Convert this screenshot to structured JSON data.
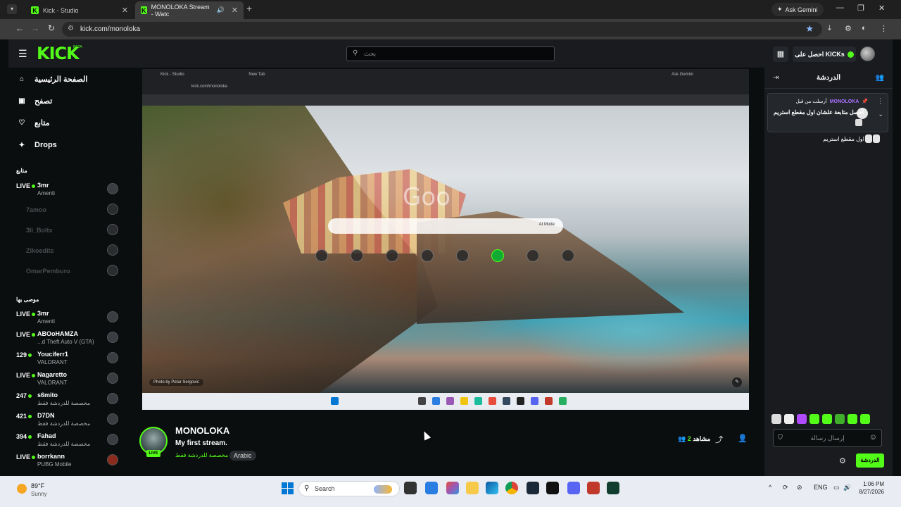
{
  "browser": {
    "tabs": [
      {
        "label": "Kick - Studio"
      },
      {
        "label": "MONOLOKA Stream - Watc"
      }
    ],
    "gemini_label": "Ask Gemini",
    "url": "kick.com/monoloka"
  },
  "header": {
    "logo": "KICK",
    "logo_badge": "BETA",
    "search_placeholder": "بحث",
    "kicks_button": "احصل على KICKs"
  },
  "sidebar": {
    "nav": [
      {
        "label": "الصفحة الرئيسية",
        "icon": "home-icon"
      },
      {
        "label": "تصفح",
        "icon": "browse-icon"
      },
      {
        "label": "متابع",
        "icon": "heart-icon"
      },
      {
        "label": "Drops",
        "icon": "drops-icon"
      }
    ],
    "following_heading": "متابع",
    "following": [
      {
        "status": "LIVE",
        "name": "3mr",
        "sub": "Amenti",
        "live": true
      },
      {
        "status": "",
        "name": "7amoo",
        "sub": "",
        "live": false
      },
      {
        "status": "",
        "name": "3li_Boltx",
        "sub": "",
        "live": false
      },
      {
        "status": "",
        "name": "Zikoedits",
        "sub": "",
        "live": false
      },
      {
        "status": "",
        "name": "OmarPemburu",
        "sub": "",
        "live": false
      }
    ],
    "recommended_heading": "موصى بها",
    "recommended": [
      {
        "status": "LIVE",
        "name": "3mr",
        "sub": "Amenti"
      },
      {
        "status": "LIVE",
        "name": "ABOoHAMZA",
        "sub": "...d Theft Auto V (GTA)"
      },
      {
        "status": "129",
        "name": "Youciferr1",
        "sub": "VALORANT"
      },
      {
        "status": "LIVE",
        "name": "Nagaretto",
        "sub": "VALORANT"
      },
      {
        "status": "247",
        "name": "s6mito",
        "sub": "مخصصة للدردشة فقط"
      },
      {
        "status": "421",
        "name": "D7DN",
        "sub": "مخصصة للدردشة فقط"
      },
      {
        "status": "394",
        "name": "Fahad",
        "sub": "مخصصة للدردشة فقط"
      },
      {
        "status": "LIVE",
        "name": "borrkann",
        "sub": "PUBG Mobile"
      }
    ]
  },
  "video": {
    "inner_tabs": [
      "Kick - Studio",
      "New Tab"
    ],
    "inner_url": "kick.com/monoloka",
    "inner_gemini": "Ask Gemini",
    "google_text": "Goo",
    "ai_mode": "AI Mode",
    "credit": "Photo by Petar Sergović"
  },
  "stream": {
    "name": "MONOLOKA",
    "title": "My first stream.",
    "category": "مخصصة للدردشة فقط",
    "tag": "Arabic",
    "live_badge": "LIVE",
    "viewers_count": "2",
    "viewers_label": "مشاهد"
  },
  "chat": {
    "title": "الدردشة",
    "pinned_by_label": "أرسلت من قبل",
    "pinned_user": "MONOLOKA",
    "pinned_message": "احصل متابعة علشان اول مقطع استريم",
    "message_text": "اول مقطع استريم",
    "input_placeholder": "إرسال رسالة",
    "send_button": "الدردشة"
  },
  "taskbar": {
    "weather_temp": "89°F",
    "weather_cond": "Sunny",
    "search_label": "Search",
    "lang": "ENG",
    "time": "1:06 PM",
    "date": "8/27/2026"
  },
  "colors": {
    "accent": "#53fc18",
    "background": "#0b0e0f",
    "panel": "#191b1f"
  }
}
